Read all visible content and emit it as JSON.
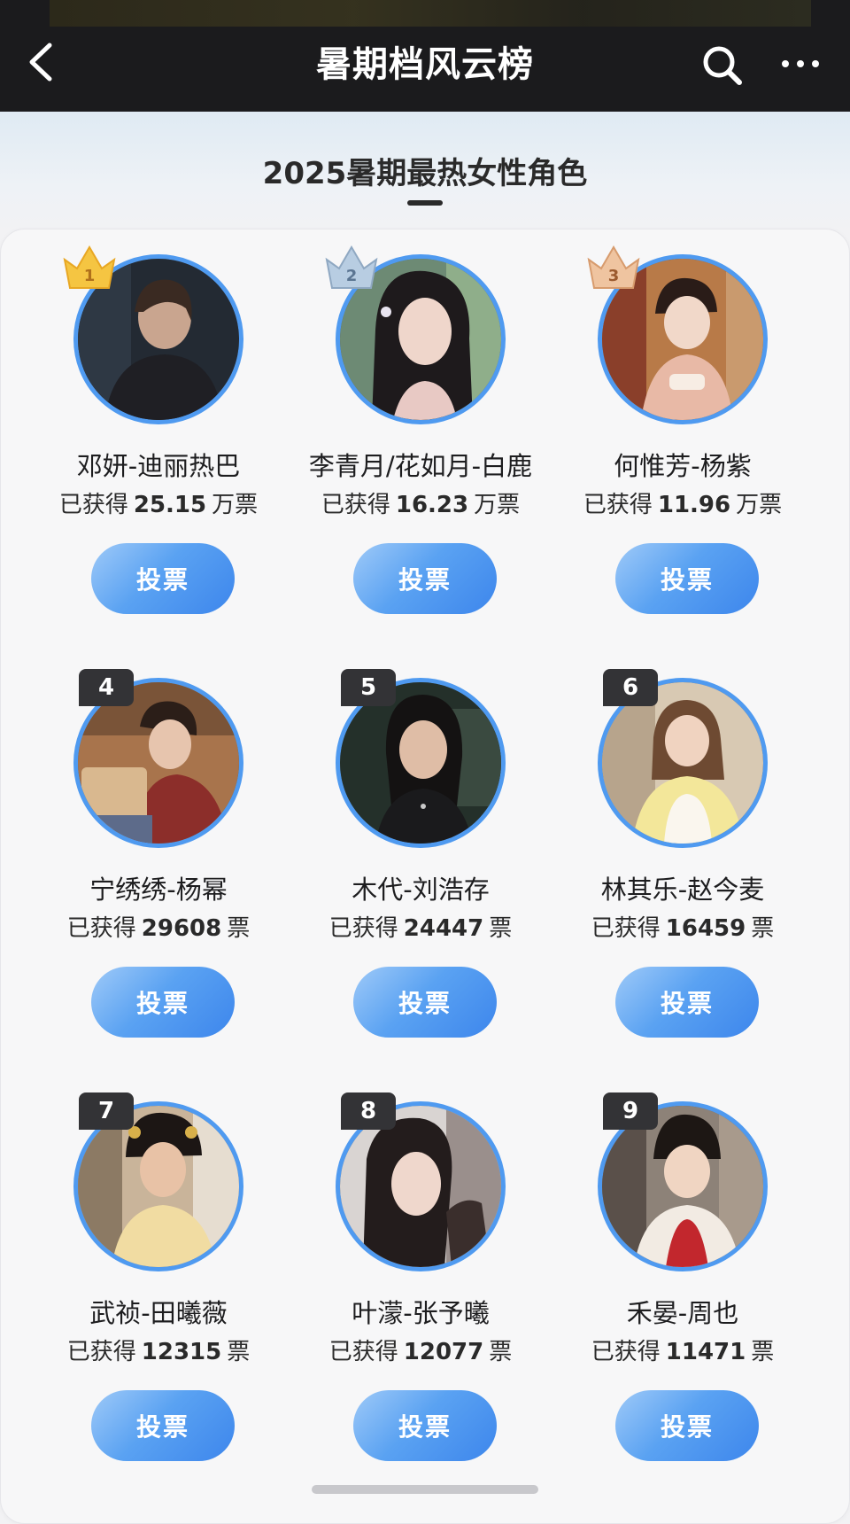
{
  "header": {
    "title": "暑期档风云榜",
    "back_icon": "chevron-left-icon",
    "search_icon": "search-icon",
    "more_icon": "more-dots-icon"
  },
  "section": {
    "title": "2025暑期最热女性角色"
  },
  "colors": {
    "accent": "#4f9af0",
    "button_start": "#9fcaf8",
    "button_end": "#3d86ec",
    "gold": "#f5c542",
    "silver": "#a9c1d8",
    "bronze": "#e3b08a",
    "badge_dark": "#333336"
  },
  "vote_prefix": "已获得",
  "vote_label": "投票",
  "items": [
    {
      "rank": "1",
      "name": "邓妍-迪丽热巴",
      "votes": "25.15",
      "unit": "万票",
      "badge": "gold-crown"
    },
    {
      "rank": "2",
      "name": "李青月/花如月-白鹿",
      "votes": "16.23",
      "unit": "万票",
      "badge": "silver-crown"
    },
    {
      "rank": "3",
      "name": "何惟芳-杨紫",
      "votes": "11.96",
      "unit": "万票",
      "badge": "bronze-crown"
    },
    {
      "rank": "4",
      "name": "宁绣绣-杨幂",
      "votes": "29608",
      "unit": "票",
      "badge": "dark-tag"
    },
    {
      "rank": "5",
      "name": "木代-刘浩存",
      "votes": "24447",
      "unit": "票",
      "badge": "dark-tag"
    },
    {
      "rank": "6",
      "name": "林其乐-赵今麦",
      "votes": "16459",
      "unit": "票",
      "badge": "dark-tag"
    },
    {
      "rank": "7",
      "name": "武祯-田曦薇",
      "votes": "12315",
      "unit": "票",
      "badge": "dark-tag"
    },
    {
      "rank": "8",
      "name": "叶濛-张予曦",
      "votes": "12077",
      "unit": "票",
      "badge": "dark-tag"
    },
    {
      "rank": "9",
      "name": "禾晏-周也",
      "votes": "11471",
      "unit": "票",
      "badge": "dark-tag"
    }
  ]
}
